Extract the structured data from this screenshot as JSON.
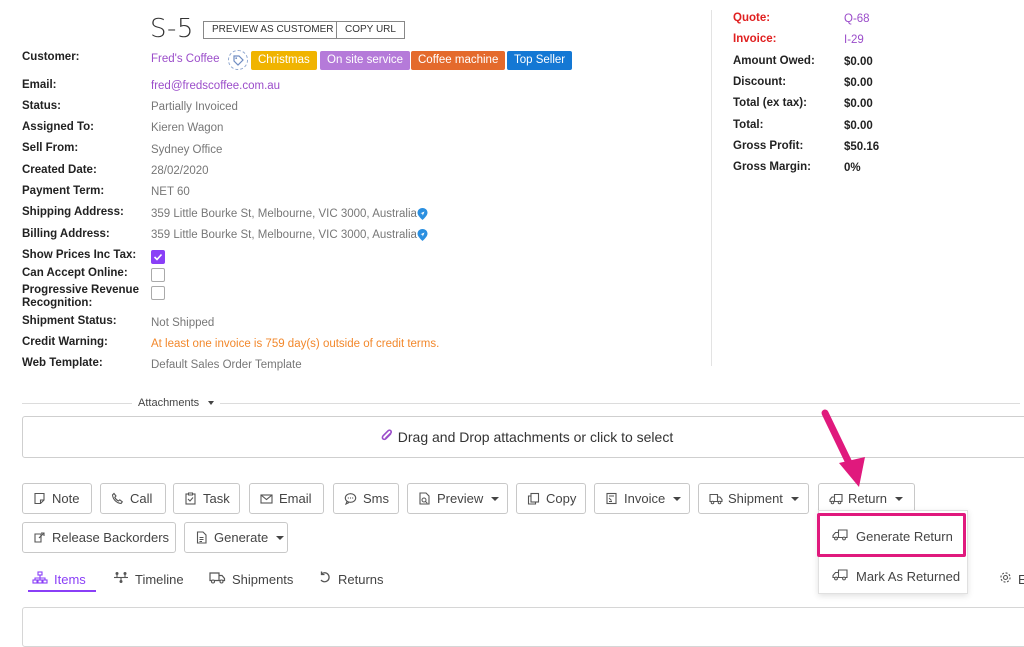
{
  "header": {
    "order_number": "S-5",
    "preview_btn": "PREVIEW AS CUSTOMER",
    "copy_url_btn": "COPY URL"
  },
  "details": {
    "customer_label": "Customer:",
    "customer_value": "Fred's Coffee",
    "tags": [
      {
        "label": "Christmas",
        "color": "#f0b400"
      },
      {
        "label": "On site service",
        "color": "#b57ad9"
      },
      {
        "label": "Coffee machine",
        "color": "#e46a2c"
      },
      {
        "label": "Top Seller",
        "color": "#1478d4"
      }
    ],
    "email_label": "Email:",
    "email_value": "fred@fredscoffee.com.au",
    "status_label": "Status:",
    "status_value": "Partially Invoiced",
    "assigned_label": "Assigned To:",
    "assigned_value": "Kieren Wagon",
    "sell_from_label": "Sell From:",
    "sell_from_value": "Sydney Office",
    "created_label": "Created Date:",
    "created_value": "28/02/2020",
    "payment_label": "Payment Term:",
    "payment_value": "NET 60",
    "shipping_label": "Shipping Address:",
    "shipping_value": "359 Little Bourke St, Melbourne, VIC 3000, Australia",
    "billing_label": "Billing Address:",
    "billing_value": "359 Little Bourke St, Melbourne, VIC 3000, Australia",
    "show_prices_label": "Show Prices Inc Tax:",
    "show_prices_checked": true,
    "accept_online_label": "Can Accept Online:",
    "accept_online_checked": false,
    "progressive_label_1": "Progressive Revenue",
    "progressive_label_2": "Recognition:",
    "progressive_checked": false,
    "shipment_status_label": "Shipment Status:",
    "shipment_status_value": "Not Shipped",
    "credit_warning_label": "Credit Warning:",
    "credit_warning_value": "At least one invoice is 759 day(s) outside of credit terms.",
    "web_template_label": "Web Template:",
    "web_template_value": "Default Sales Order Template"
  },
  "summary": {
    "quote_label": "Quote:",
    "quote_value": "Q-68",
    "invoice_label": "Invoice:",
    "invoice_value": "I-29",
    "amount_owed_label": "Amount Owed:",
    "amount_owed_value": "$0.00",
    "discount_label": "Discount:",
    "discount_value": "$0.00",
    "total_ex_label": "Total (ex tax):",
    "total_ex_value": "$0.00",
    "total_label": "Total:",
    "total_value": "$0.00",
    "gross_profit_label": "Gross Profit:",
    "gross_profit_value": "$50.16",
    "gross_margin_label": "Gross Margin:",
    "gross_margin_value": "0%"
  },
  "attachments": {
    "label": "Attachments",
    "dropzone": "Drag and Drop attachments or click to select"
  },
  "toolbar": {
    "note": "Note",
    "call": "Call",
    "task": "Task",
    "email": "Email",
    "sms": "Sms",
    "preview": "Preview",
    "copy": "Copy",
    "invoice": "Invoice",
    "shipment": "Shipment",
    "return": "Return",
    "release_backorders": "Release Backorders",
    "generate": "Generate"
  },
  "return_menu": {
    "generate_return": "Generate Return",
    "mark_as_returned": "Mark As Returned"
  },
  "tabs": {
    "items": "Items",
    "timeline": "Timeline",
    "shipments": "Shipments",
    "returns": "Returns",
    "edge_label": "E"
  },
  "colors": {
    "accent": "#8a3ff7",
    "link": "#9b4dca",
    "warning": "#f2882c",
    "highlight": "#e0197d",
    "red_label": "#e02020"
  }
}
